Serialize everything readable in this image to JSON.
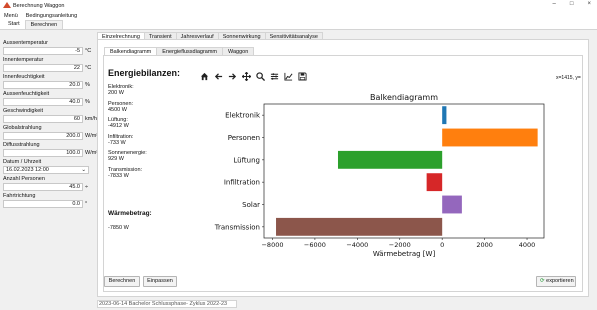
{
  "window": {
    "title": "Berechnung Waggon",
    "minimize": "–",
    "maximize": "□",
    "close": "×"
  },
  "menu": [
    "Menü",
    "Bedingungsanleitung"
  ],
  "ribbon": [
    "Start",
    "Berechnen"
  ],
  "inputs": [
    {
      "label": "Aussentemperatur",
      "value": "-5",
      "unit": "°C"
    },
    {
      "label": "Innentemperatur",
      "value": "22",
      "unit": "°C"
    },
    {
      "label": "Innenfeuchtigkeit",
      "value": "20.0",
      "unit": "%"
    },
    {
      "label": "Aussenfeuchtigkeit",
      "value": "40.0",
      "unit": "%"
    },
    {
      "label": "Geschwindigkeit",
      "value": "60",
      "unit": "km/h"
    },
    {
      "label": "Globalstrahlung",
      "value": "200.0",
      "unit": "W/m²"
    },
    {
      "label": "Diffusstrahlung",
      "value": "100.0",
      "unit": "W/m²"
    }
  ],
  "datetime": {
    "label": "Datum / Uhrzeit",
    "value": "16.02.2023 12:00",
    "arrow": "⌄"
  },
  "persons": {
    "label": "Anzahl Personen",
    "value": "45.0",
    "unit": "÷"
  },
  "direction": {
    "label": "Fahrtrichtung",
    "value": "0.0",
    "unit": "°"
  },
  "main_tabs": [
    "Einzelrechnung",
    "Transient",
    "Jahresverlauf",
    "Sonnenwirkung",
    "Sensitivitätsanalyse"
  ],
  "sub_tabs": [
    "Balkendiagramm",
    "Energieflussdiagramm",
    "Waggon"
  ],
  "energy": {
    "title": "Energiebilanzen:",
    "items": [
      {
        "label": "Elektronik:",
        "value": "200 W"
      },
      {
        "label": "Personen:",
        "value": "4500 W"
      },
      {
        "label": "Lüftung:",
        "value": "-4912 W"
      },
      {
        "label": "Infiltration:",
        "value": "-733 W"
      },
      {
        "label": "Sonnenenergie:",
        "value": "929 W"
      },
      {
        "label": "Transmission:",
        "value": "-7833 W"
      }
    ],
    "waermebetrag_title": "Wärmebetrag:",
    "waermebetrag_value": "-7850 W"
  },
  "toolbar_icons": [
    "home-icon",
    "back-icon",
    "forward-icon",
    "pan-icon",
    "zoom-icon",
    "configure-icon",
    "edit-axes-icon",
    "save-icon"
  ],
  "coords": "x=1415, y=",
  "buttons": {
    "berechnen": "Berechnen",
    "einpassen": "Einpassen",
    "exportieren": "exportieren"
  },
  "status": "2023-06-14 Bachelor Schlussphase- Zyklus 2022-23",
  "chart_data": {
    "type": "bar",
    "orientation": "horizontal",
    "title": "Balkendiagramm",
    "xlabel": "Wärmebetrag [W]",
    "ylabel": "",
    "categories": [
      "Elektronik",
      "Personen",
      "Lüftung",
      "Infiltration",
      "Solar",
      "Transmission"
    ],
    "values": [
      200,
      4500,
      -4912,
      -733,
      929,
      -7833
    ],
    "colors": [
      "#1f77b4",
      "#ff7f0e",
      "#2ca02c",
      "#d62728",
      "#9467bd",
      "#8c564b"
    ],
    "xlim": [
      -8400,
      4800
    ],
    "xticks": [
      -8000,
      -6000,
      -4000,
      -2000,
      0,
      2000,
      4000
    ],
    "xtick_labels": [
      "−8000",
      "−6000",
      "−4000",
      "−2000",
      "0",
      "2000",
      "4000"
    ],
    "grid": false,
    "legend": "none"
  }
}
